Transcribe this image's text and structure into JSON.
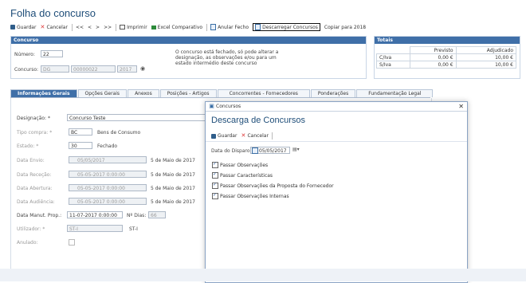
{
  "page": {
    "title": "Folha do concurso"
  },
  "toolbar": {
    "guardar": "Guardar",
    "cancelar": "Cancelar",
    "nav": [
      "<<",
      "<",
      ">",
      ">>"
    ],
    "imprimir": "Imprimir",
    "excel": "Excel Comparativo",
    "anular": "Anular Fecho",
    "descarregar": "Descarregar Concursos",
    "copiar": "Copiar para 2018"
  },
  "concurso": {
    "header": "Concurso",
    "numero_label": "Número:",
    "numero_value": "22",
    "concurso_label": "Concurso:",
    "concurso_type": "DG",
    "concurso_code": "00000022",
    "concurso_year": "2017",
    "notice": "O concurso está fechado, só pode alterar a designação, as observações e/ou para um estado intermédio deste concurso"
  },
  "totais": {
    "header": "Totais",
    "col_previsto": "Previsto",
    "col_adjudicado": "Adjudicado",
    "rows": [
      {
        "label": "C/Iva",
        "previsto": "0,00 €",
        "adjudicado": "10,00 €"
      },
      {
        "label": "S/Iva",
        "previsto": "0,00 €",
        "adjudicado": "10,00 €"
      }
    ]
  },
  "tabs": [
    "Informações Gerais",
    "Opções Gerais",
    "Anexos",
    "Posições - Artigos",
    "Concorrentes - Fornecedores",
    "Ponderações",
    "Fundamentação Legal"
  ],
  "form": {
    "designacao_label": "Designação: *",
    "designacao_value": "Concurso Teste",
    "tipo_label": "Tipo compra: *",
    "tipo_code": "BC",
    "tipo_desc": "Bens de Consumo",
    "estado_label": "Estado: *",
    "estado_code": "30",
    "estado_desc": "Fechado",
    "envio_label": "Data Envio:",
    "envio_value": "05/05/2017",
    "envio_text": "5 de Maio de 2017",
    "rececao_label": "Data Receção:",
    "rececao_value": "05-05-2017 0:00:00",
    "rececao_text": "5 de Maio de 2017",
    "abertura_label": "Data Abertura:",
    "abertura_value": "05-05-2017 0:00:00",
    "abertura_text": "5 de Maio de 2017",
    "audiencia_label": "Data Audiência:",
    "audiencia_value": "05-05-2017 0:00:00",
    "audiencia_text": "5 de Maio de 2017",
    "manut_label": "Data Manut. Prop.:",
    "manut_value": "11-07-2017 0:00:00",
    "ndias_label": "Nº Dias:",
    "ndias_value": "66",
    "utilizador_label": "Utilizador: *",
    "utilizador_code": "ST-I",
    "utilizador_name": "ST-I",
    "anulado_label": "Anulado:"
  },
  "dialog": {
    "window_title": "Concursos",
    "title": "Descarga de Concursos",
    "guardar": "Guardar",
    "cancelar": "Cancelar",
    "date_label": "Data do Disparo:",
    "date_value": "05/05/2017",
    "options": [
      "Passar Observações",
      "Passar Características",
      "Passar Observações da Proposta do Fornecedor",
      "Passar Observações Internas"
    ]
  }
}
